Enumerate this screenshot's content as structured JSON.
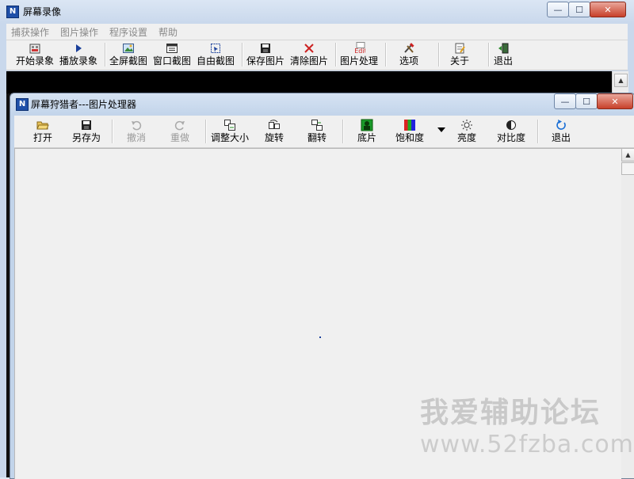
{
  "outer_window": {
    "title": "屏幕录像",
    "app_icon_letter": "N",
    "buttons": {
      "minimize": "—",
      "maximize": "☐",
      "close": "✕"
    }
  },
  "menu": {
    "items": [
      "捕获操作",
      "图片操作",
      "程序设置",
      "帮助"
    ]
  },
  "main_toolbar": {
    "buttons": [
      "开始录象",
      "播放录象",
      "全屏截图",
      "窗口截图",
      "自由截图",
      "保存图片",
      "清除图片",
      "图片处理",
      "选项",
      "关于",
      "退出"
    ],
    "edit_icon_text": "Edit"
  },
  "inner_window": {
    "title": "屏幕狩猎者---图片处理器",
    "app_icon_letter": "N",
    "buttons": {
      "minimize": "—",
      "maximize": "☐",
      "close": "✕"
    }
  },
  "editor_toolbar": {
    "buttons": [
      "打开",
      "另存为",
      "撤消",
      "重做",
      "调整大小",
      "旋转",
      "翻转",
      "底片",
      "饱和度",
      "亮度",
      "对比度",
      "退出"
    ]
  },
  "watermark": {
    "line1": "我爱辅助论坛",
    "line2": "www.52fzba.com"
  },
  "colors": {
    "negative_icon": "#1a9a2a",
    "saturation_icon": [
      "#d22",
      "#2a2",
      "#22d"
    ],
    "exit_icon": "#1a6fd6"
  }
}
